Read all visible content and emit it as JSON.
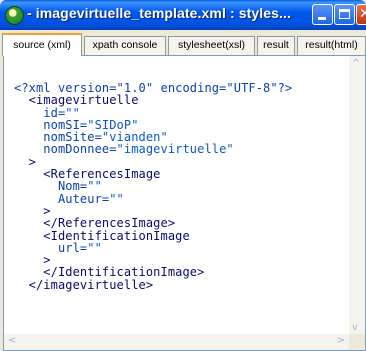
{
  "window": {
    "title": "- imagevirtuelle_template.xml : styles...",
    "app_icon": "app-globe-icon",
    "controls": {
      "minimize_icon": "minimize-icon",
      "maximize_icon": "maximize-icon",
      "close_icon": "close-icon",
      "close_glyph": "✕"
    }
  },
  "tabs": [
    {
      "label": "source (xml)",
      "active": true
    },
    {
      "label": "xpath console",
      "active": false
    },
    {
      "label": "stylesheet(xsl)",
      "active": false
    },
    {
      "label": "result",
      "active": false
    },
    {
      "label": "result(html)",
      "active": false
    }
  ],
  "code": {
    "lines": [
      [
        {
          "t": "<?xml version=\"1.0\" encoding=\"UTF-8\"?>",
          "c": "pi"
        }
      ],
      [
        {
          "t": "  <imagevirtuelle",
          "c": "tag"
        }
      ],
      [
        {
          "t": "    id=",
          "c": "attr"
        },
        {
          "t": "\"\"",
          "c": "val"
        }
      ],
      [
        {
          "t": "    nomSI=",
          "c": "attr"
        },
        {
          "t": "\"SIDoP\"",
          "c": "val"
        }
      ],
      [
        {
          "t": "    nomSite=",
          "c": "attr"
        },
        {
          "t": "\"vianden\"",
          "c": "val"
        }
      ],
      [
        {
          "t": "    nomDonnee=",
          "c": "attr"
        },
        {
          "t": "\"imagevirtuelle\"",
          "c": "val"
        }
      ],
      [
        {
          "t": "  >",
          "c": "tag"
        }
      ],
      [
        {
          "t": "    <ReferencesImage",
          "c": "tag"
        }
      ],
      [
        {
          "t": "      Nom=",
          "c": "attr"
        },
        {
          "t": "\"\"",
          "c": "val"
        }
      ],
      [
        {
          "t": "      Auteur=",
          "c": "attr"
        },
        {
          "t": "\"\"",
          "c": "val"
        }
      ],
      [
        {
          "t": "    >",
          "c": "tag"
        }
      ],
      [
        {
          "t": "    </ReferencesImage>",
          "c": "tag"
        }
      ],
      [
        {
          "t": "    <IdentificationImage",
          "c": "tag"
        }
      ],
      [
        {
          "t": "      url=",
          "c": "attr"
        },
        {
          "t": "\"\"",
          "c": "val"
        }
      ],
      [
        {
          "t": "    >",
          "c": "tag"
        }
      ],
      [
        {
          "t": "    </IdentificationImage>",
          "c": "tag"
        }
      ],
      [
        {
          "t": "  </imagevirtuelle>",
          "c": "tag"
        }
      ]
    ]
  },
  "scrollbars": {
    "up_arrow": "^",
    "down_arrow": "v",
    "left_arrow": "<",
    "right_arrow": ">"
  },
  "colors": {
    "titlebar": "#0058ee",
    "tab_active_accent": "#f3a33a",
    "tag": "#0a0a6e",
    "attr": "#0b3fb0",
    "value": "#0a58c8"
  }
}
